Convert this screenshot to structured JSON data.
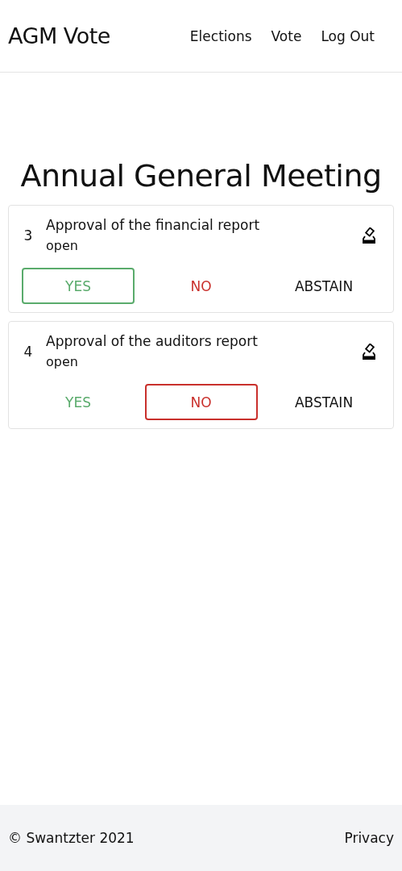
{
  "header": {
    "brand": "AGM Vote",
    "nav": [
      {
        "label": "Elections"
      },
      {
        "label": "Vote"
      },
      {
        "label": "Log Out"
      }
    ]
  },
  "title": "Annual General Meeting",
  "motions": [
    {
      "number": "3",
      "title": "Approval of the financial report",
      "status": "open",
      "options": [
        {
          "kind": "yes",
          "label": "YES",
          "selected": true
        },
        {
          "kind": "no",
          "label": "NO",
          "selected": false
        },
        {
          "kind": "abstain",
          "label": "ABSTAIN",
          "selected": false
        }
      ]
    },
    {
      "number": "4",
      "title": "Approval of the auditors report",
      "status": "open",
      "options": [
        {
          "kind": "yes",
          "label": "YES",
          "selected": false
        },
        {
          "kind": "no",
          "label": "NO",
          "selected": true
        },
        {
          "kind": "abstain",
          "label": "ABSTAIN",
          "selected": false
        }
      ]
    }
  ],
  "footer": {
    "copyright": "© Swantzter 2021",
    "link": "Privacy"
  }
}
